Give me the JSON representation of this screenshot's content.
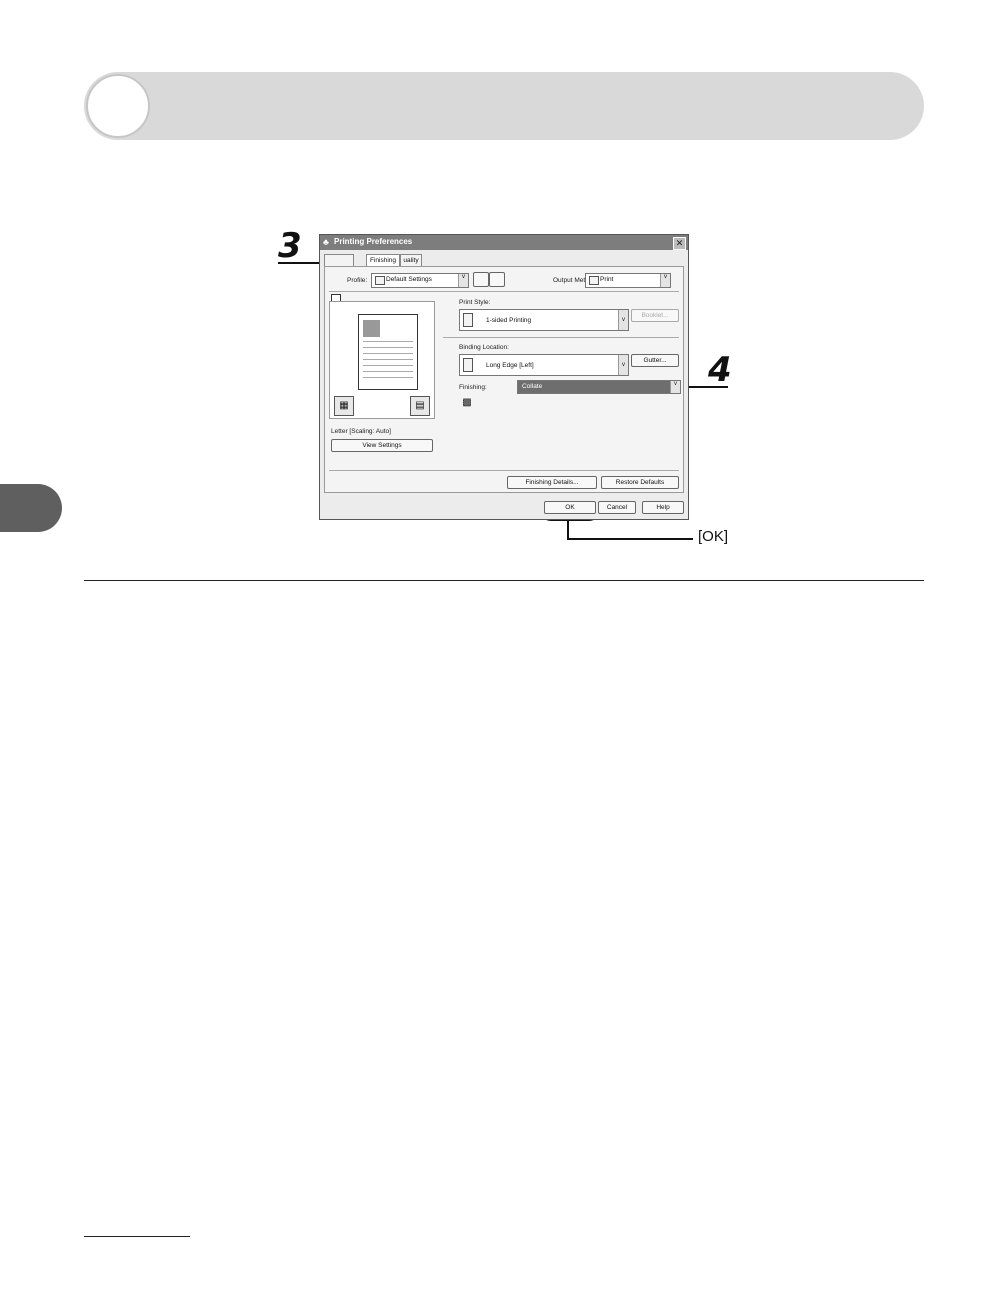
{
  "steps": {
    "three": "3",
    "four": "4"
  },
  "ok_callout": "[OK]",
  "dialog": {
    "title": "Printing Preferences",
    "close": "✕",
    "tabs": [
      "Finishing",
      "uality"
    ],
    "profile_label": "Profile:",
    "profile_value": "Default Settings",
    "output_label": "Output Method:",
    "output_value": "Print",
    "print_style_label": "Print Style:",
    "print_style_value": "1-sided Printing",
    "booklet_button": "Booklet...",
    "binding_label": "Binding Location:",
    "binding_value": "Long Edge [Left]",
    "gutter_button": "Gutter...",
    "finishing_label": "Finishing:",
    "finishing_value": "Collate",
    "paper_info": "Letter [Scaling: Auto]",
    "view_settings_button": "View Settings",
    "finishing_details_button": "Finishing Details...",
    "restore_defaults_button": "Restore Defaults",
    "ok_button": "OK",
    "cancel_button": "Cancel",
    "help_button": "Help"
  }
}
